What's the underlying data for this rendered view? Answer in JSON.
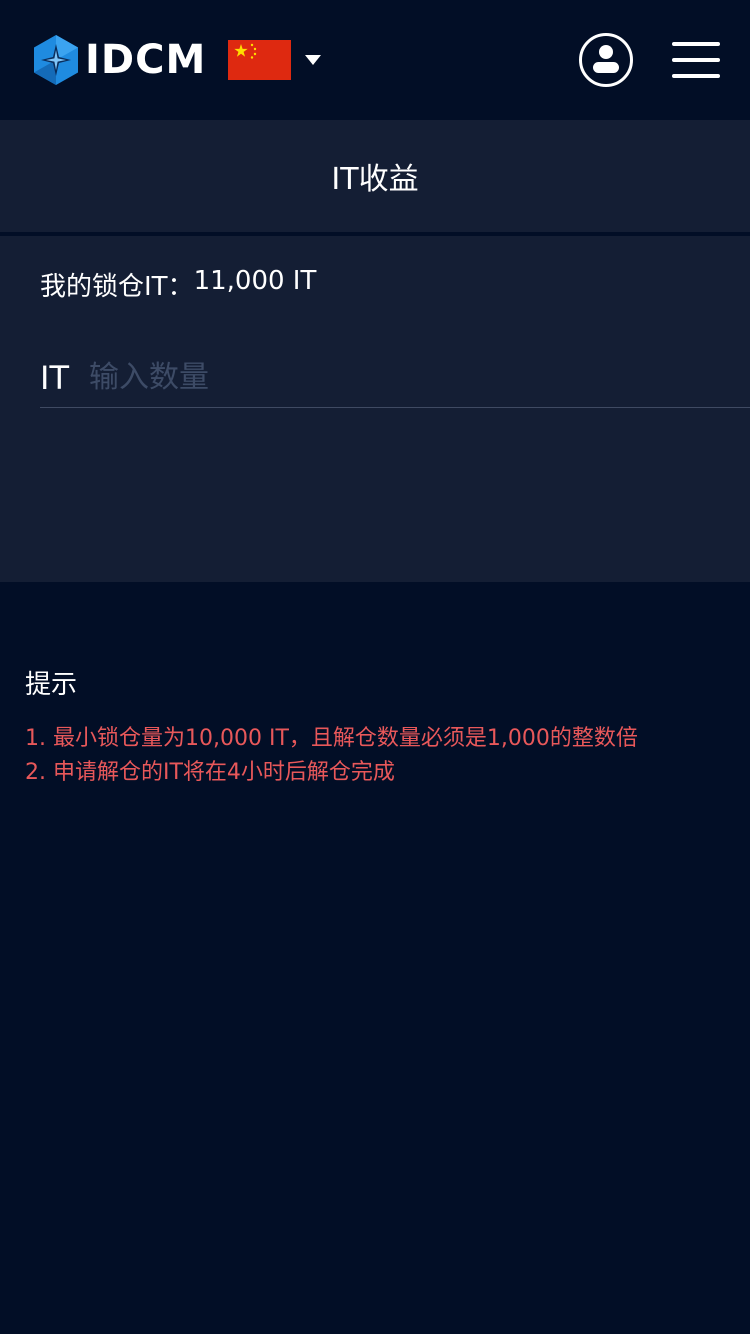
{
  "header": {
    "brand": "IDCM",
    "language_flag": "china-flag-icon",
    "language_caret": "caret-down-icon",
    "user_icon": "user-icon",
    "menu_icon": "hamburger-menu-icon"
  },
  "page": {
    "title": "IT收益"
  },
  "lock_info": {
    "label": "我的锁仓IT：",
    "value": "11,000 IT"
  },
  "amount_input": {
    "unit": "IT",
    "placeholder": "输入数量",
    "value": ""
  },
  "tips": {
    "title": "提示",
    "items": [
      "1. 最小锁仓量为10,000 IT，且解仓数量必须是1,000的整数倍",
      "2. 申请解仓的IT将在4小时后解仓完成"
    ]
  },
  "colors": {
    "background": "#020e26",
    "panel": "#141e34",
    "tip_text": "#e8585a",
    "logo_blue": "#1e88e5"
  }
}
